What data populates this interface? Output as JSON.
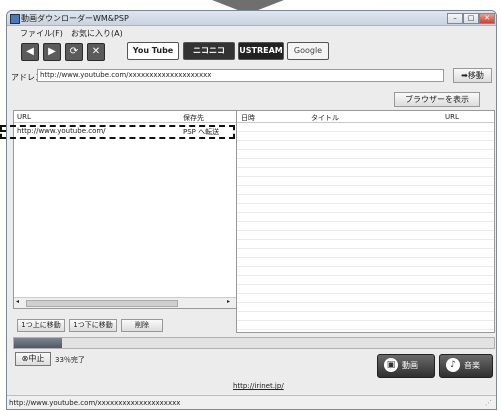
{
  "window": {
    "title": "動画ダウンローダーWM&PSP"
  },
  "menu": {
    "file": "ファイル(F)",
    "favorites": "お気に入り(A)"
  },
  "toolbar": {
    "youtube_label": "You Tube",
    "niconico_label": "ニコニコ",
    "ustream_label": "USTREAM",
    "google_label": "Google"
  },
  "address": {
    "label": "アドレス",
    "value": "http://www.youtube.com/xxxxxxxxxxxxxxxxxxxx",
    "go_label": "移動"
  },
  "show_browser_label": "ブラウザーを表示",
  "left_list": {
    "headers": {
      "url": "URL",
      "save": "保存先"
    },
    "rows": [
      {
        "url": "http://www.youtube.com/",
        "save": "PSP へ転送"
      }
    ]
  },
  "right_list": {
    "headers": {
      "date": "日時",
      "title": "タイトル",
      "url": "URL"
    }
  },
  "buttons": {
    "up": "1つ上に移動",
    "down": "1つ下に移動",
    "delete": "削除"
  },
  "progress": {
    "value": 0.1
  },
  "stop_label": "中止",
  "percent_text": "33％完了",
  "video_label": "動画",
  "music_label": "音楽",
  "bottom_link": "http://irinet.jp/",
  "status_text": "http://www.youtube.com/xxxxxxxxxxxxxxxxxxxx"
}
